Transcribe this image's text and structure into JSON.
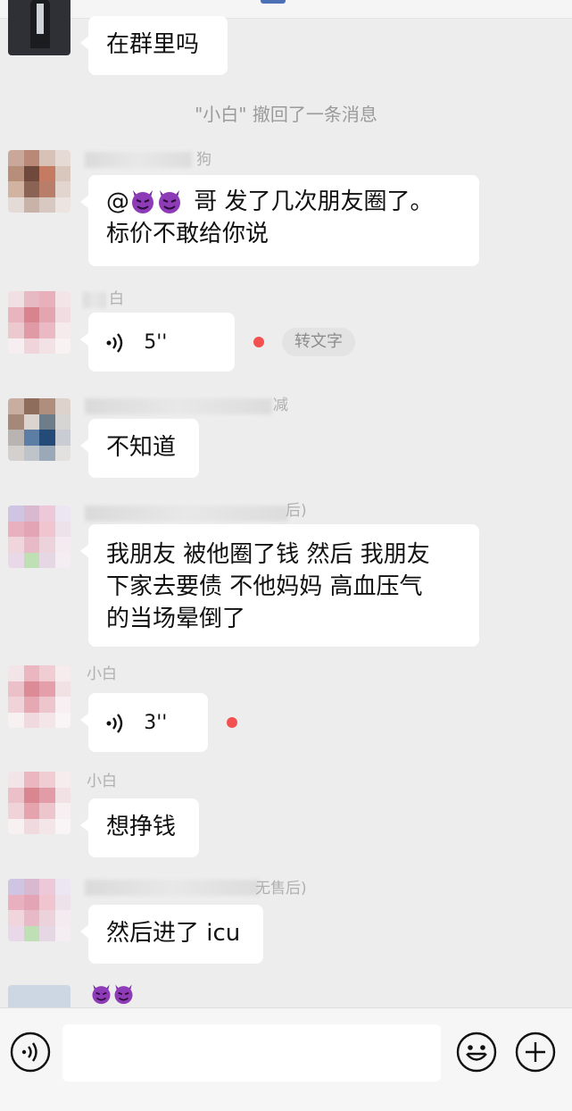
{
  "system_message": "\"小白\" 撤回了一条消息",
  "messages": [
    {
      "text": "在群里吗"
    },
    {
      "text_line1": "哥 发了几次朋友圈了。",
      "text_line2": "标价不敢给你说",
      "name_tail": "狗",
      "mention_prefix": "@"
    },
    {
      "voice_length": "5''",
      "name_tail": "白",
      "convert_label": "转文字"
    },
    {
      "text": "不知道",
      "name_tail": "减"
    },
    {
      "line1": "我朋友 被他圈了钱 然后 我朋友",
      "line2": "下家去要债 不他妈妈 高血压气",
      "line3": "的当场晕倒了",
      "name_tail": "后)"
    },
    {
      "voice_length": "3''",
      "name_tail": "小白"
    },
    {
      "text": "想挣钱",
      "name_tail": "小白"
    },
    {
      "text": "然后进了 icu",
      "name_tail": "无售后)"
    }
  ],
  "icons": {
    "voice_toggle": "voice-mode-icon",
    "emoji": "emoji-icon",
    "plus": "plus-icon",
    "devil_emoji": "purple-devil-emoji"
  },
  "colors": {
    "background": "#ededed",
    "bubble": "#ffffff",
    "unread_dot": "#f35151",
    "devil": "#8e3bb8"
  }
}
